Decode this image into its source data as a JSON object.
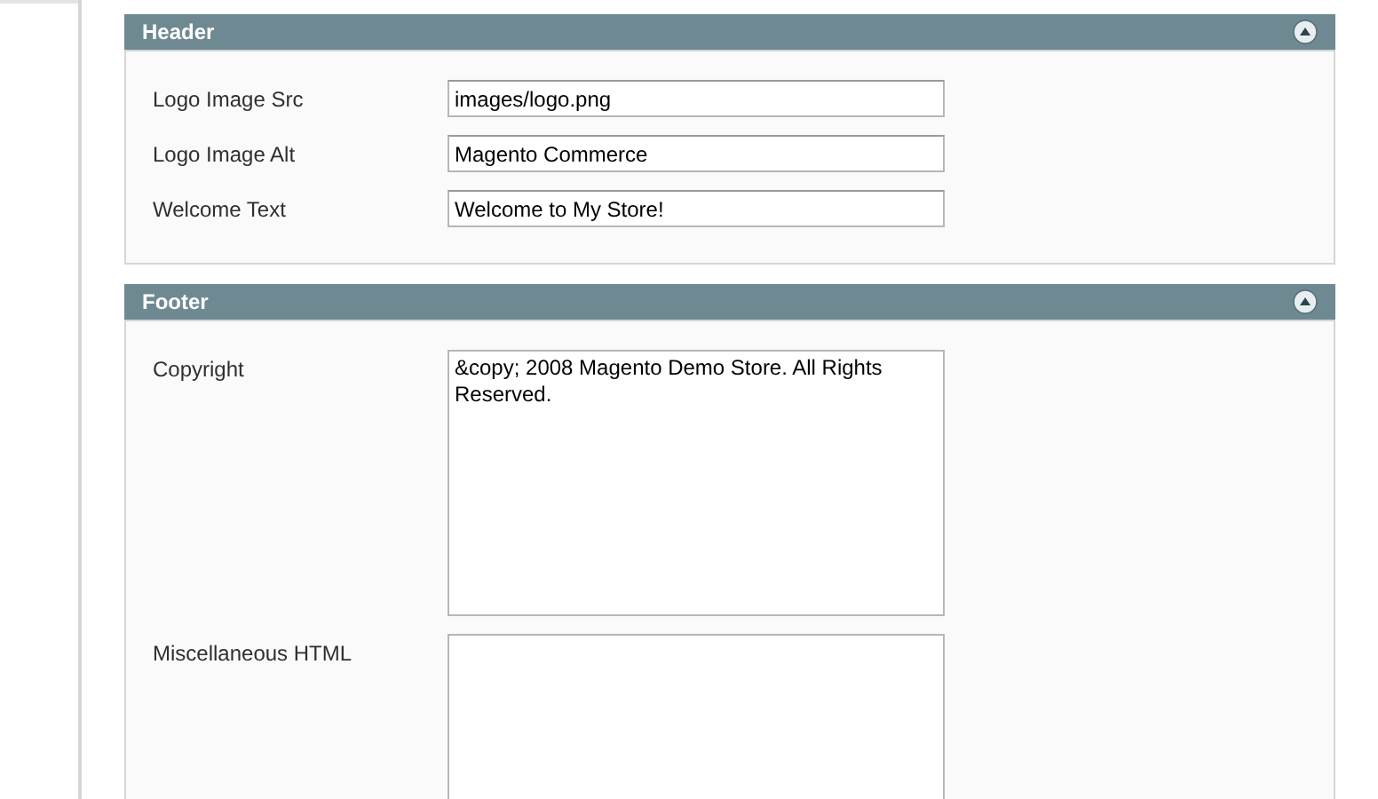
{
  "sections": [
    {
      "title": "Header",
      "expanded": true,
      "fields": [
        {
          "kind": "input",
          "label": "Logo Image Src",
          "value": "images/logo.png"
        },
        {
          "kind": "input",
          "label": "Logo Image Alt",
          "value": "Magento Commerce"
        },
        {
          "kind": "input",
          "label": "Welcome Text",
          "value": "Welcome to My Store!"
        }
      ]
    },
    {
      "title": "Footer",
      "expanded": true,
      "fields": [
        {
          "kind": "textarea",
          "label": "Copyright",
          "value": "&copy; 2008 Magento Demo Store. All Rights Reserved."
        },
        {
          "kind": "textarea",
          "label": "Miscellaneous HTML"
        }
      ]
    }
  ]
}
